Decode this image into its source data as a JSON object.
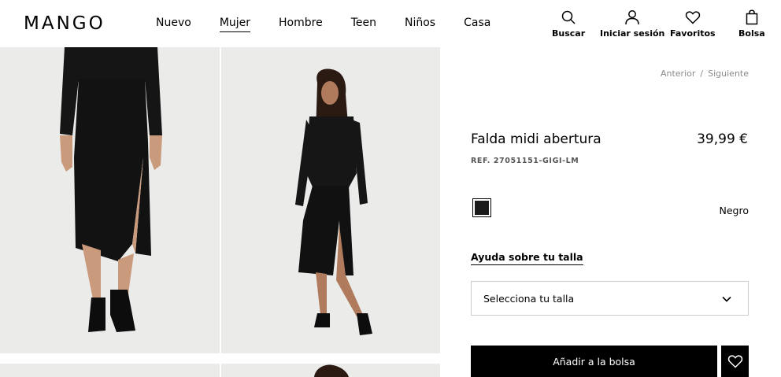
{
  "brand": {
    "logo": "MANGO"
  },
  "nav": {
    "items": [
      {
        "label": "Nuevo",
        "active": false
      },
      {
        "label": "Mujer",
        "active": true
      },
      {
        "label": "Hombre",
        "active": false
      },
      {
        "label": "Teen",
        "active": false
      },
      {
        "label": "Niños",
        "active": false
      },
      {
        "label": "Casa",
        "active": false
      }
    ]
  },
  "utility": {
    "search_label": "Buscar",
    "login_label": "Iniciar sesión",
    "favorites_label": "Favoritos",
    "bag_label": "Bolsa"
  },
  "pager": {
    "prev_label": "Anterior",
    "separator": "/",
    "next_label": "Siguiente"
  },
  "product": {
    "name": "Falda midi abertura",
    "price": "39,99 €",
    "ref": "REF. 27051151-GIGI-LM",
    "color_name": "Negro",
    "color_hex": "#1a1a1a",
    "size_help": "Ayuda sobre tu talla",
    "size_placeholder": "Selecciona tu talla",
    "add_to_bag": "Añadir a la bolsa"
  },
  "colors": {
    "accent": "#000000",
    "photo_bg": "#ececea"
  }
}
